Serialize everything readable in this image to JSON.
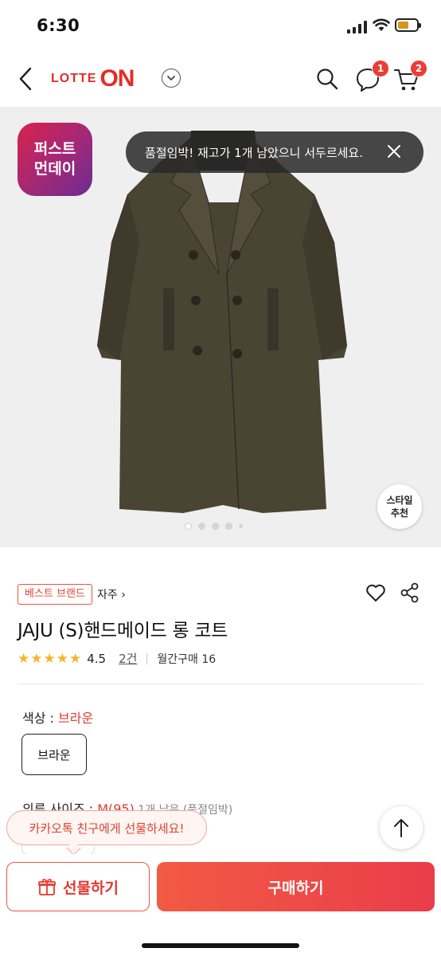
{
  "status_bar": {
    "time": "6:30"
  },
  "header": {
    "logo_lotte": "LOTTE",
    "logo_on": "ON",
    "chat_badge": "1",
    "cart_badge": "2"
  },
  "gallery": {
    "promo_badge_line1": "퍼스트",
    "promo_badge_line2": "먼데이",
    "stock_toast": "품절임박! 재고가 1개 남았으니 서두르세요.",
    "style_rec_line1": "스타일",
    "style_rec_line2": "추천",
    "current_image": 1,
    "image_count": 5
  },
  "product": {
    "brand_badge": "베스트 브랜드",
    "brand_name": "자주 ›",
    "title": "JAJU (S)핸드메이드 롱 코트",
    "stars": "★★★★★",
    "rating": "4.5",
    "review_count": "2건",
    "monthly_purchase": "월간구매 16"
  },
  "options": {
    "color_label": "색상 : ",
    "color_value": "브라운",
    "color_chip": "브라운",
    "size_label": "의류 사이즈 : ",
    "size_value": "M(95)",
    "size_meta": " 1개 남음 (품절임박)"
  },
  "kakao_bubble": "카카오톡 친구에게 선물하세요!",
  "bottom_bar": {
    "gift_label": "선물하기",
    "buy_label": "구매하기"
  },
  "colors": {
    "brand_red": "#e32d26",
    "accent_star": "#f3b529",
    "buy_gradient_start": "#f25a44",
    "buy_gradient_end": "#ea3d4a"
  }
}
